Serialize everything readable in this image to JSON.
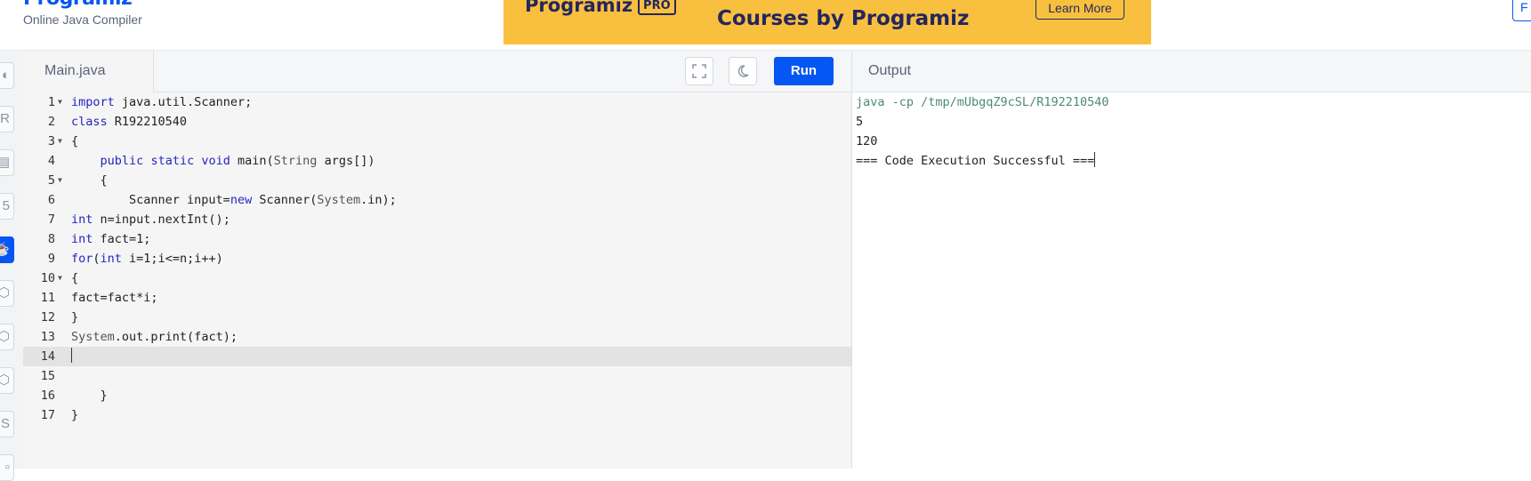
{
  "header": {
    "brand": "Programiz",
    "subtitle": "Online Java Compiler",
    "ad": {
      "logo": "Programiz",
      "pro_badge": "PRO",
      "headline": "Courses by Programiz",
      "button": "Learn More",
      "background": "#f9c03f"
    },
    "edge_button": "F"
  },
  "sidebar": {
    "items": [
      {
        "icon": "python-icon",
        "active": false
      },
      {
        "icon": "r-icon",
        "active": false
      },
      {
        "icon": "sql-icon",
        "active": false
      },
      {
        "icon": "html-icon",
        "active": false
      },
      {
        "icon": "java-icon",
        "active": true
      },
      {
        "icon": "c-icon",
        "active": false
      },
      {
        "icon": "cpp-icon",
        "active": false
      },
      {
        "icon": "csharp-icon",
        "active": false
      },
      {
        "icon": "js-icon",
        "active": false
      },
      {
        "icon": "extra-icon",
        "active": false
      }
    ]
  },
  "editor": {
    "tab": "Main.java",
    "run_label": "Run",
    "accent": "#0556f3",
    "current_line": 14,
    "lines": [
      "import java.util.Scanner;",
      "class R192210540",
      "{",
      "    public static void main(String args[])",
      "    {",
      "        Scanner input=new Scanner(System.in);",
      "int n=input.nextInt();",
      "int fact=1;",
      "for(int i=1;i<=n;i++)",
      "{",
      "fact=fact*i;",
      "}",
      "System.out.print(fact);",
      "",
      "",
      "    }",
      "}"
    ],
    "line_numbers": [
      "1",
      "2",
      "3",
      "4",
      "5",
      "6",
      "7",
      "8",
      "9",
      "10",
      "11",
      "12",
      "13",
      "14",
      "15",
      "16",
      "17"
    ]
  },
  "output": {
    "title": "Output",
    "lines": [
      "java -cp /tmp/mUbgqZ9cSL/R192210540",
      "5",
      "120",
      "=== Code Execution Successful ==="
    ]
  }
}
